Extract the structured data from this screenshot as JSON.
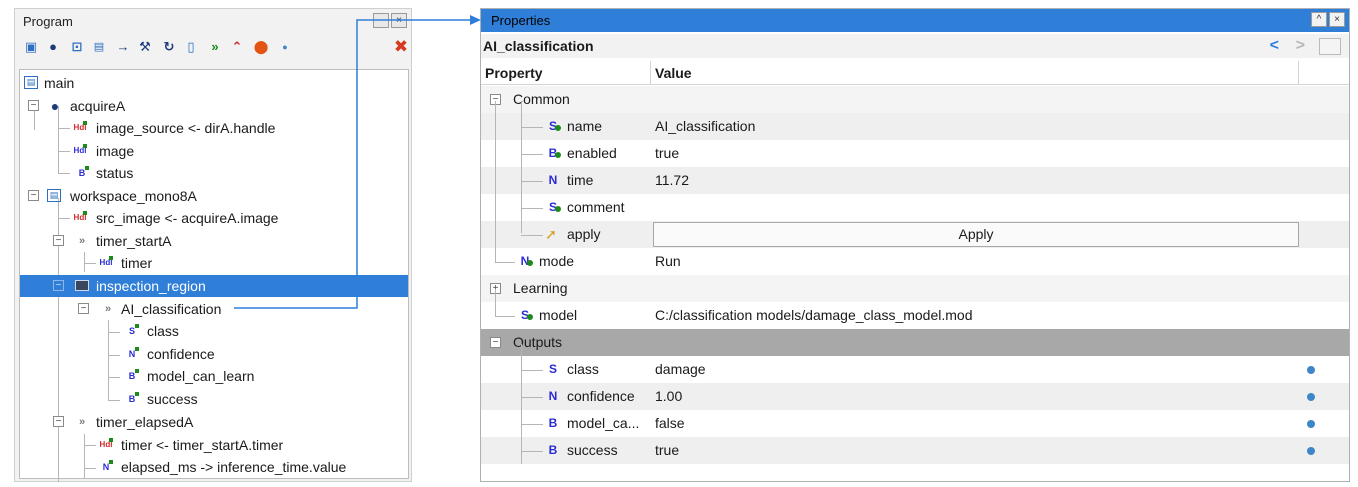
{
  "program": {
    "title": "Program",
    "title_buttons": [
      "-",
      "×"
    ],
    "toolbar_icons": [
      "acquire-icon",
      "camera-icon",
      "add-icon",
      "workspace-icon",
      "arrow-icon",
      "tool-icon",
      "redo-icon",
      "document-icon",
      "double-chevron-icon",
      "step-icon",
      "stop-icon",
      "dot-icon",
      "delete-icon"
    ],
    "tree": [
      {
        "label": "main"
      },
      {
        "label": "acquireA"
      },
      {
        "label": "image_source <- dirA.handle"
      },
      {
        "label": "image"
      },
      {
        "label": "status"
      },
      {
        "label": "workspace_mono8A"
      },
      {
        "label": "src_image <- acquireA.image"
      },
      {
        "label": "timer_startA"
      },
      {
        "label": "timer"
      },
      {
        "label": "inspection_region"
      },
      {
        "label": "AI_classification"
      },
      {
        "label": "class"
      },
      {
        "label": "confidence"
      },
      {
        "label": "model_can_learn"
      },
      {
        "label": "success"
      },
      {
        "label": "timer_elapsedA"
      },
      {
        "label": "timer <- timer_startA.timer"
      },
      {
        "label": "elapsed_ms -> inference_time.value"
      }
    ],
    "icon_text": {
      "hdl": "Hdl",
      "b": "B",
      "n": "N",
      "s": "S"
    }
  },
  "properties": {
    "title": "Properties",
    "title_buttons": [
      "^",
      "×"
    ],
    "object_name": "AI_classification",
    "nav": {
      "back": "<",
      "forward": ">"
    },
    "header": {
      "property": "Property",
      "value": "Value"
    },
    "rows": [
      {
        "name": "Common",
        "value": ""
      },
      {
        "name": "name",
        "value": "AI_classification"
      },
      {
        "name": "enabled",
        "value": "true"
      },
      {
        "name": "time",
        "value": "11.72"
      },
      {
        "name": "comment",
        "value": ""
      },
      {
        "name": "apply",
        "value": ""
      },
      {
        "name": "mode",
        "value": "Run"
      },
      {
        "name": "Learning",
        "value": ""
      },
      {
        "name": "model",
        "value": "C:/classification models/damage_class_model.mod"
      },
      {
        "name": "Outputs",
        "value": ""
      },
      {
        "name": "class",
        "value": "damage"
      },
      {
        "name": "confidence",
        "value": "1.00"
      },
      {
        "name": "model_ca...",
        "value": "false"
      },
      {
        "name": "success",
        "value": "true"
      }
    ],
    "apply_label": "Apply",
    "type_letters": {
      "s": "S",
      "b": "B",
      "n": "N"
    },
    "expander": {
      "minus": "−",
      "plus": "+"
    }
  },
  "colors": {
    "selection": "#2f7ed8",
    "status_dot": "#3f86c9",
    "connector": "#2f7ed8"
  }
}
